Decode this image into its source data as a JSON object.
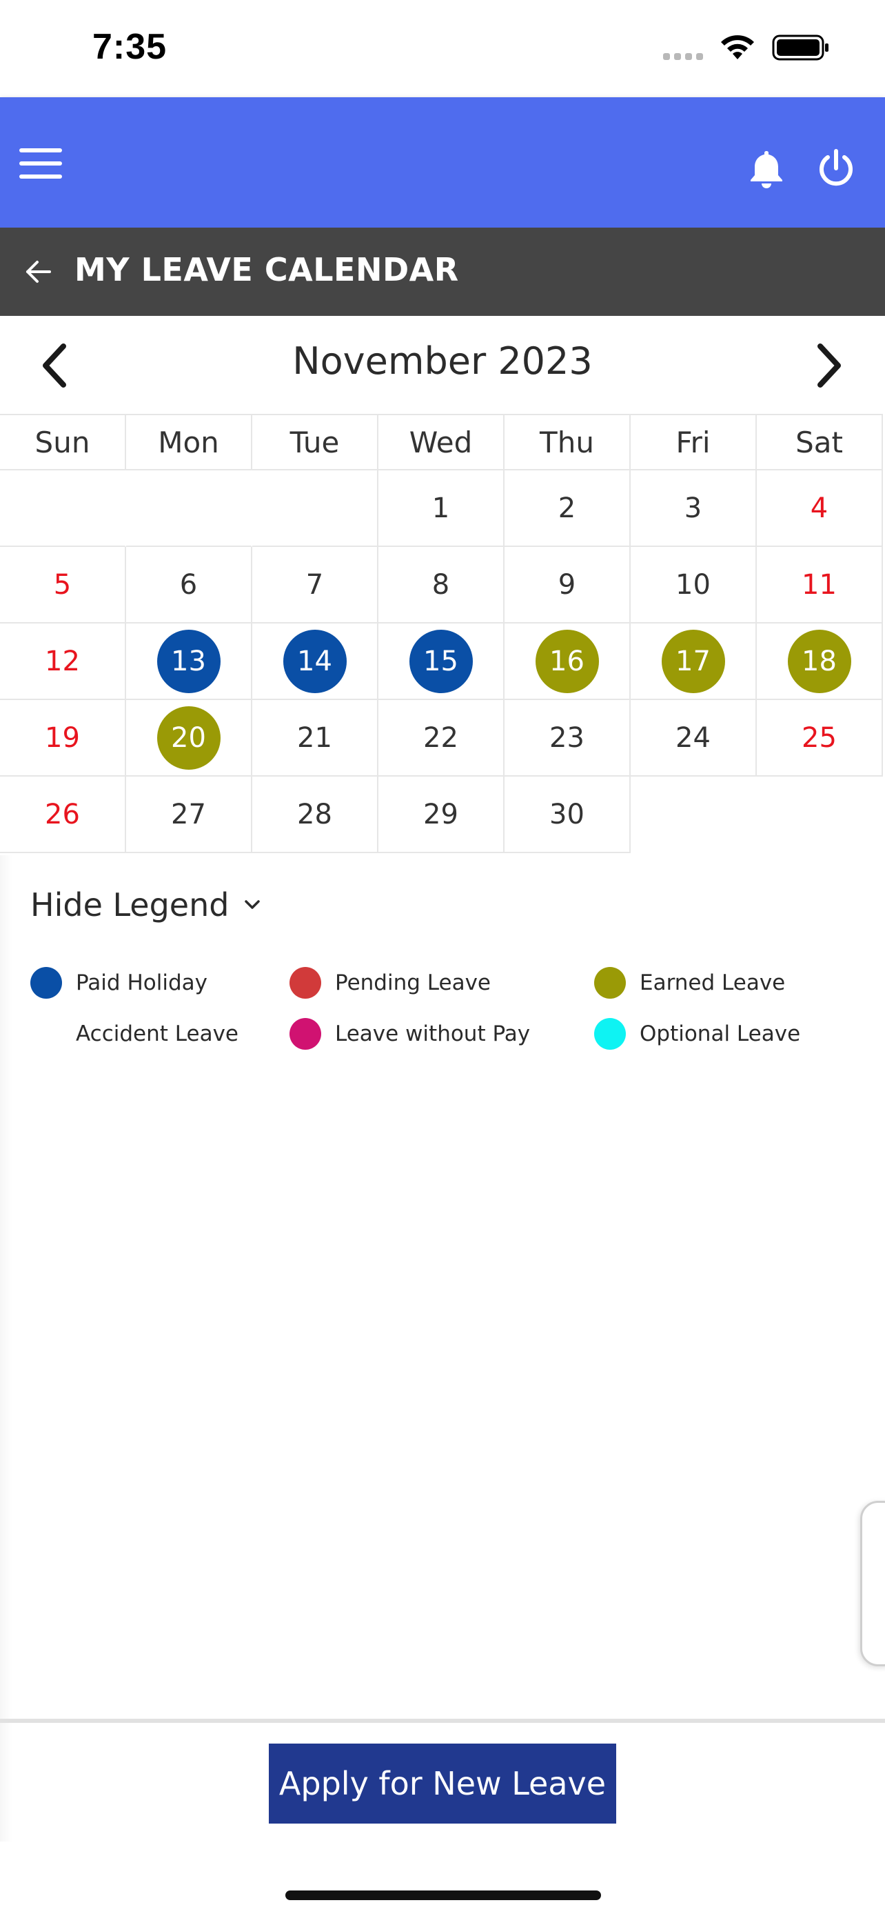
{
  "status_bar": {
    "time": "7:35"
  },
  "header": {
    "menu_icon": "hamburger-icon",
    "bell_icon": "bell-icon",
    "power_icon": "power-icon"
  },
  "title_bar": {
    "back_icon": "arrow-left-icon",
    "title": "MY LEAVE CALENDAR"
  },
  "calendar": {
    "month_label": "November 2023",
    "weekdays": [
      "Sun",
      "Mon",
      "Tue",
      "Wed",
      "Thu",
      "Fri",
      "Sat"
    ],
    "weeks": [
      [
        "",
        "",
        "",
        "1",
        "2",
        "3",
        "4"
      ],
      [
        "5",
        "6",
        "7",
        "8",
        "9",
        "10",
        "11"
      ],
      [
        "12",
        "13",
        "14",
        "15",
        "16",
        "17",
        "18"
      ],
      [
        "19",
        "20",
        "21",
        "22",
        "23",
        "24",
        "25"
      ],
      [
        "26",
        "27",
        "28",
        "29",
        "30",
        "",
        ""
      ]
    ],
    "marked_days": {
      "13": "Paid Holiday",
      "14": "Paid Holiday",
      "15": "Paid Holiday",
      "16": "Earned Leave",
      "17": "Earned Leave",
      "18": "Earned Leave",
      "20": "Earned Leave"
    },
    "weekend_color": "#e8141e"
  },
  "legend": {
    "toggle_label": "Hide Legend",
    "items": [
      {
        "label": "Paid Holiday",
        "color": "#0a4fa6"
      },
      {
        "label": "Pending Leave",
        "color": "#d13a3a"
      },
      {
        "label": "Earned Leave",
        "color": "#9a9a06"
      },
      {
        "label": "Accident Leave",
        "color": "transparent"
      },
      {
        "label": "Leave without Pay",
        "color": "#d01271"
      },
      {
        "label": "Optional Leave",
        "color": "#0ef3f3"
      }
    ]
  },
  "actions": {
    "apply_label": "Apply for New Leave"
  },
  "colors": {
    "header": "#4f6cee",
    "title_bar": "#454545",
    "apply_button": "#21398f"
  }
}
